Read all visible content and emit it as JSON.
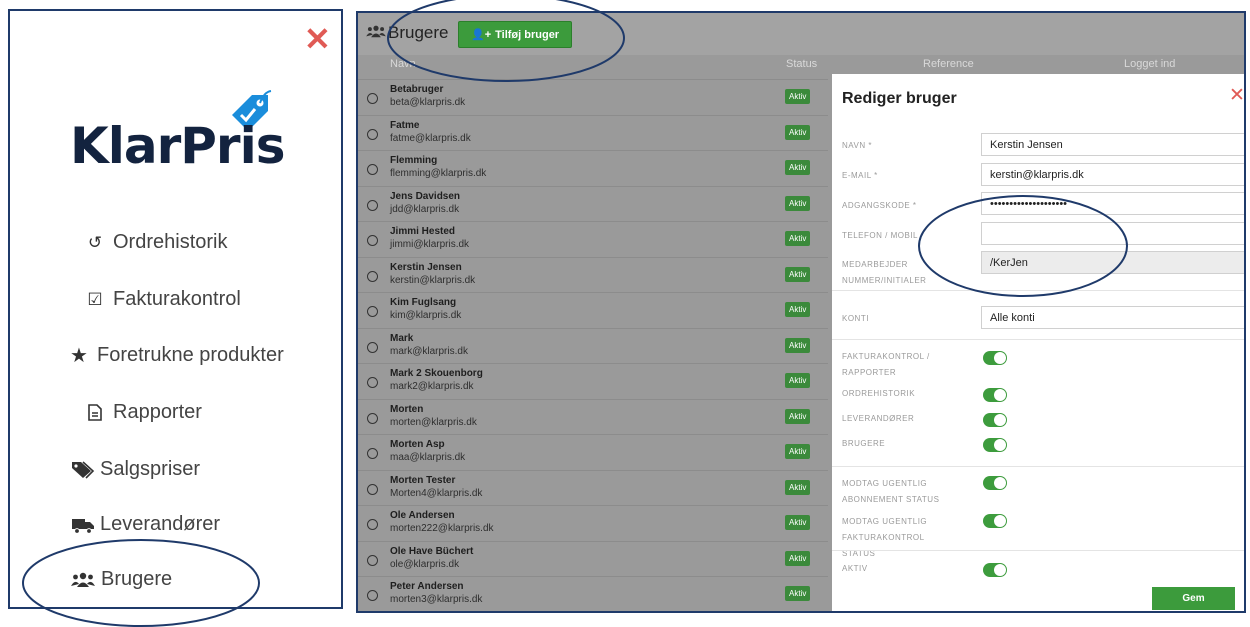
{
  "sidebar": {
    "close_label": "✕",
    "logo_text": "KlarPris",
    "items": [
      {
        "label": "Ordrehistorik",
        "icon": "history-icon"
      },
      {
        "label": "Fakturakontrol",
        "icon": "checkbox-icon"
      },
      {
        "label": "Foretrukne produkter",
        "icon": "star-icon"
      },
      {
        "label": "Rapporter",
        "icon": "document-icon"
      },
      {
        "label": "Salgspriser",
        "icon": "tags-icon"
      },
      {
        "label": "Leverandører",
        "icon": "truck-icon"
      },
      {
        "label": "Brugere",
        "icon": "users-icon"
      }
    ]
  },
  "users_page": {
    "title": "Brugere",
    "add_button": "Tilføj bruger",
    "columns": [
      "Navn",
      "Status",
      "Reference",
      "Logget ind"
    ],
    "rows": [
      {
        "name": "Betabruger",
        "email": "beta@klarpris.dk",
        "status": "Aktiv"
      },
      {
        "name": "Fatme",
        "email": "fatme@klarpris.dk",
        "status": "Aktiv"
      },
      {
        "name": "Flemming",
        "email": "flemming@klarpris.dk",
        "status": "Aktiv"
      },
      {
        "name": "Jens Davidsen",
        "email": "jdd@klarpris.dk",
        "status": "Aktiv"
      },
      {
        "name": "Jimmi Hested",
        "email": "jimmi@klarpris.dk",
        "status": "Aktiv"
      },
      {
        "name": "Kerstin Jensen",
        "email": "kerstin@klarpris.dk",
        "status": "Aktiv"
      },
      {
        "name": "Kim Fuglsang",
        "email": "kim@klarpris.dk",
        "status": "Aktiv"
      },
      {
        "name": "Mark",
        "email": "mark@klarpris.dk",
        "status": "Aktiv"
      },
      {
        "name": "Mark 2 Skouenborg",
        "email": "mark2@klarpris.dk",
        "status": "Aktiv"
      },
      {
        "name": "Morten",
        "email": "morten@klarpris.dk",
        "status": "Aktiv"
      },
      {
        "name": "Morten Asp",
        "email": "maa@klarpris.dk",
        "status": "Aktiv"
      },
      {
        "name": "Morten Tester",
        "email": "Morten4@klarpris.dk",
        "status": "Aktiv"
      },
      {
        "name": "Ole Andersen",
        "email": "morten222@klarpris.dk",
        "status": "Aktiv"
      },
      {
        "name": "Ole Have Büchert",
        "email": "ole@klarpris.dk",
        "status": "Aktiv"
      },
      {
        "name": "Peter Andersen",
        "email": "morten3@klarpris.dk",
        "status": "Aktiv"
      }
    ]
  },
  "dialog": {
    "title": "Rediger bruger",
    "close_label": "✕",
    "fields": {
      "name_label": "NAVN *",
      "name_value": "Kerstin Jensen",
      "email_label": "E-MAIL *",
      "email_value": "kerstin@klarpris.dk",
      "password_label": "ADGANGSKODE *",
      "password_value": "••••••••••••••••••••",
      "phone_label": "TELEFON / MOBIL",
      "phone_value": "",
      "employee_label": "MEDARBEJDER NUMMER/INITIALER",
      "employee_value": "/KerJen",
      "accounts_label": "KONTI",
      "accounts_value": "Alle konti"
    },
    "toggles": [
      {
        "label": "FAKTURAKONTROL / RAPPORTER",
        "on": true
      },
      {
        "label": "ORDREHISTORIK",
        "on": true
      },
      {
        "label": "LEVERANDØRER",
        "on": true
      },
      {
        "label": "BRUGERE",
        "on": true
      },
      {
        "label": "MODTAG UGENTLIG ABONNEMENT STATUS",
        "on": true
      },
      {
        "label": "MODTAG UGENTLIG FAKTURAKONTROL STATUS",
        "on": true
      },
      {
        "label": "AKTIV",
        "on": true
      }
    ],
    "save_button": "Gem"
  },
  "colors": {
    "accent_green": "#3c9b3c",
    "close_red": "#e05a55",
    "annotation_navy": "#1f3a6a",
    "logo_blue": "#1a8ddb"
  }
}
